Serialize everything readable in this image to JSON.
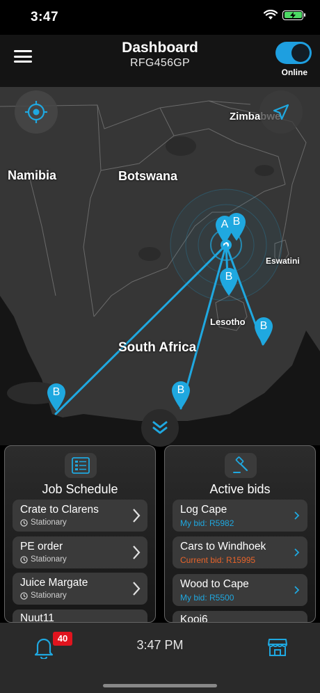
{
  "status_bar": {
    "time": "3:47",
    "icons": [
      "wifi-icon",
      "battery-charging-icon"
    ]
  },
  "header": {
    "title": "Dashboard",
    "subtitle": "RFG456GP",
    "online_label": "Online",
    "online": true
  },
  "map": {
    "labels": {
      "namibia": "Namibia",
      "botswana": "Botswana",
      "zimbabwe": "Zimbabwe",
      "eswatini": "Eswatini",
      "lesotho": "Lesotho",
      "south_africa": "South Africa"
    },
    "markers": {
      "a": "A",
      "b": "B"
    },
    "buttons": [
      "locate-icon",
      "navigate-icon",
      "chevron-double-down-icon"
    ],
    "route_color": "#1fa8e0"
  },
  "job_schedule": {
    "title": "Job Schedule",
    "items": [
      {
        "title": "Crate to Clarens",
        "status": "Stationary"
      },
      {
        "title": "PE order",
        "status": "Stationary"
      },
      {
        "title": "Juice Margate",
        "status": "Stationary"
      },
      {
        "title": "Nuut11"
      }
    ]
  },
  "active_bids": {
    "title": "Active bids",
    "items": [
      {
        "title": "Log Cape",
        "bid": "My bid: R5982",
        "color": "#1fa8e0"
      },
      {
        "title": "Cars to Windhoek",
        "bid": "Current bid: R15995",
        "color": "#e8642a"
      },
      {
        "title": "Wood to Cape",
        "bid": "My bid: R5500",
        "color": "#1fa8e0"
      },
      {
        "title": "Kooi6"
      }
    ]
  },
  "bottom_bar": {
    "notification_count": "40",
    "time": "3:47 PM"
  },
  "colors": {
    "accent": "#1fa8e0",
    "badge": "#e0141e",
    "current_bid": "#e8642a"
  }
}
